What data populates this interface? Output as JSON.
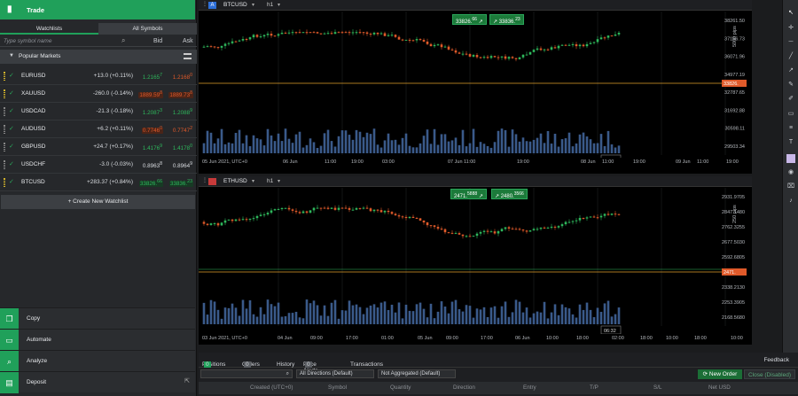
{
  "app": {
    "title": "Trade"
  },
  "watchlist": {
    "tabs": [
      "Watchlists",
      "All Symbols"
    ],
    "search_placeholder": "Type symbol name",
    "bid_label": "Bid",
    "ask_label": "Ask",
    "section_title": "Popular Markets",
    "rows": [
      {
        "symbol": "EURUSD",
        "change": "+13.0 (+0.11%)",
        "bid": "1.2165",
        "bid_sup": "7",
        "ask": "1.2168",
        "ask_sup": "0",
        "bid_color": "#2eb85c",
        "ask_color": "#e05a2a",
        "bid_bg": "",
        "ask_bg": "",
        "grip": "y"
      },
      {
        "symbol": "XAUUSD",
        "change": "-260.0 (-0.14%)",
        "bid": "1889.59",
        "bid_sup": "8",
        "ask": "1889.73",
        "ask_sup": "8",
        "bid_color": "#e05a2a",
        "ask_color": "#e05a2a",
        "bid_bg": "#4a2418",
        "ask_bg": "#4a2418",
        "grip": "y"
      },
      {
        "symbol": "USDCAD",
        "change": "-21.3 (-0.18%)",
        "bid": "1.2087",
        "bid_sup": "3",
        "ask": "1.2088",
        "ask_sup": "9",
        "bid_color": "#2eb85c",
        "ask_color": "#2eb85c",
        "bid_bg": "",
        "ask_bg": "",
        "grip": "n"
      },
      {
        "symbol": "AUDUSD",
        "change": "+6.2 (+0.11%)",
        "bid": "0.7746",
        "bid_sup": "0",
        "ask": "0.7747",
        "ask_sup": "2",
        "bid_color": "#e05a2a",
        "ask_color": "#e05a2a",
        "bid_bg": "#4a2418",
        "ask_bg": "",
        "grip": "n"
      },
      {
        "symbol": "GBPUSD",
        "change": "+24.7 (+0.17%)",
        "bid": "1.4176",
        "bid_sup": "9",
        "ask": "1.4178",
        "ask_sup": "0",
        "bid_color": "#2eb85c",
        "ask_color": "#2eb85c",
        "bid_bg": "",
        "ask_bg": "",
        "grip": "n"
      },
      {
        "symbol": "USDCHF",
        "change": "-3.0 (-0.03%)",
        "bid": "0.8963",
        "bid_sup": "8",
        "ask": "0.8964",
        "ask_sup": "9",
        "bid_color": "#d9dce0",
        "ask_color": "#d9dce0",
        "bid_bg": "",
        "ask_bg": "",
        "grip": "n"
      },
      {
        "symbol": "BTCUSD",
        "change": "+283.37 (+0.84%)",
        "bid": "33826.",
        "bid_sup": "66",
        "ask": "33836.",
        "ask_sup": "23",
        "bid_color": "#2eb85c",
        "ask_color": "#2eb85c",
        "bid_bg": "#173a24",
        "ask_bg": "#173a24",
        "grip": "y"
      }
    ],
    "create_label": "+ Create New Watchlist"
  },
  "menu": [
    {
      "label": "Copy",
      "icon": "copy-icon"
    },
    {
      "label": "Automate",
      "icon": "automate-icon"
    },
    {
      "label": "Analyze",
      "icon": "analyze-icon"
    },
    {
      "label": "Deposit",
      "icon": "deposit-icon"
    }
  ],
  "charts": [
    {
      "symbol": "BTCUSD",
      "icon_letter": "A",
      "icon_color": "#2e6fd8",
      "timeframe": "h1",
      "sell": "33826.",
      "sell_sup": "66",
      "buy": "33836.",
      "buy_sup": "23",
      "pips": "5000 pips",
      "current_price": "33826.",
      "current_price_sup": "66",
      "time_label": "06:32",
      "prices": [
        "38261.50",
        "37166.73",
        "36071.96",
        "34977.19",
        "32787.65",
        "31692.88",
        "30598.11",
        "29503.34"
      ],
      "times": [
        "05 Jun 2021, UTC+0",
        "06 Jun",
        "11:00",
        "19:00",
        "03:00",
        "07 Jun",
        "11:00",
        "19:00",
        "08 Jun",
        "11:00",
        "19:00",
        "09 Jun",
        "11:00",
        "19:00",
        "10 Jun",
        "11:00"
      ]
    },
    {
      "symbol": "ETHUSD",
      "icon_letter": "",
      "icon_color": "#c73a3a",
      "timeframe": "h1",
      "sell": "2471.",
      "sell_sup": "5888",
      "buy": "2480.",
      "buy_sup": "3566",
      "pips": "250 pips",
      "current_price": "2471.",
      "current_price_sup": "5888",
      "current_price_2": "2519.355",
      "time_label": "06:32",
      "prices": [
        "2931.9705",
        "2847.1480",
        "2762.3255",
        "2677.5030",
        "2592.6805",
        "2423.0355",
        "2338.2130",
        "2253.3905",
        "2168.5680"
      ],
      "times": [
        "03 Jun 2021, UTC+0",
        "04 Jun",
        "09:00",
        "17:00",
        "01:00",
        "05 Jun",
        "09:00",
        "17:00",
        "06 Jun",
        "10:00",
        "18:00",
        "02:00",
        "18:00",
        "10:00",
        "18:00",
        "10:00",
        "10:00"
      ]
    }
  ],
  "bottom": {
    "tabs": [
      {
        "label": "Positions",
        "count": "0"
      },
      {
        "label": "Orders",
        "count": "0"
      },
      {
        "label": "History",
        "count": ""
      },
      {
        "label": "Price Alerts",
        "count": "0"
      },
      {
        "label": "Transactions",
        "count": ""
      }
    ],
    "feedback": "Feedback",
    "directions": "All Directions (Default)",
    "aggregation": "Not Aggregated (Default)",
    "new_order": "New Order",
    "close_disabled": "Close (Disabled)",
    "columns": [
      "Created (UTC+0)",
      "Symbol",
      "Quantity",
      "Direction",
      "Entry",
      "T/P",
      "S/L",
      "Net USD"
    ]
  },
  "colors": {
    "accent": "#20a05a",
    "up": "#2eb85c",
    "down": "#e05a2a"
  }
}
